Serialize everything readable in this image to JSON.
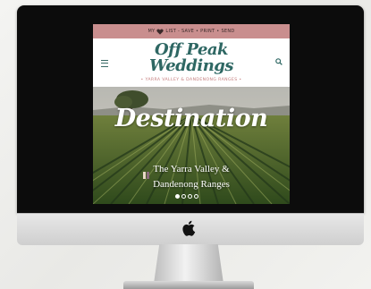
{
  "colors": {
    "topbar": "#c98e8e",
    "logo": "#2e6763",
    "tagline": "#c47c7c",
    "bezel": "#0c0c0c"
  },
  "topbar": {
    "my_text": "MY",
    "heart_icon": "heart-icon",
    "actions_text": "LIST - SAVE • PRINT • SEND"
  },
  "header": {
    "menu_icon": "hamburger-menu-icon",
    "search_icon": "search-icon",
    "logo_line1": "Off Peak",
    "logo_line2": "Weddings",
    "tagline": "• YARRA VALLEY & DANDENONG RANGES •"
  },
  "hero": {
    "title": "Destination",
    "subtitle_line1": "The Yarra Valley &",
    "subtitle_line2": "Dandenong Ranges",
    "slide_count": 4,
    "active_slide": 1
  },
  "device": {
    "logo_icon": "apple-logo-icon"
  }
}
